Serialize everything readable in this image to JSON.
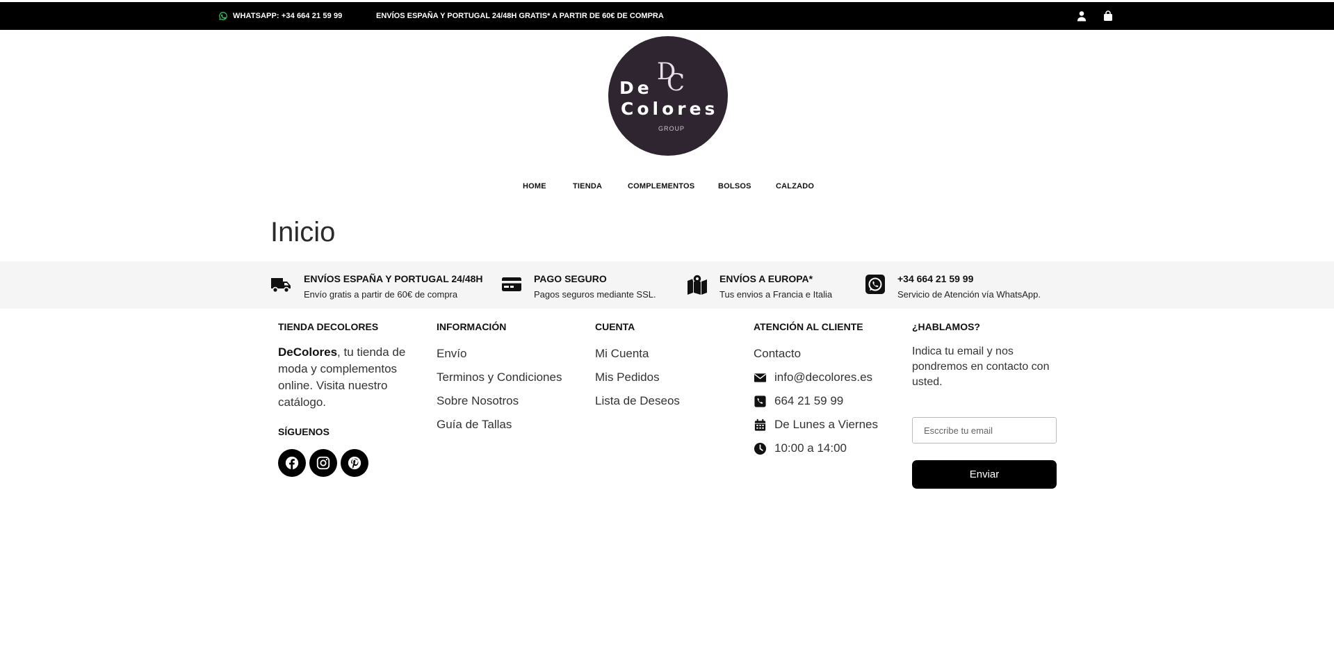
{
  "topbar": {
    "whatsapp": "WHATSAPP: +34 664 21 59 99",
    "shipping": "ENVÍOS ESPAÑA Y PORTUGAL 24/48H GRATIS* A PARTIR DE 60€ DE COMPRA",
    "whatsapp_icon_color": "#25d366"
  },
  "logo": {
    "monogram": "DC",
    "line1": "De",
    "line2": "Colores",
    "line3": "GROUP",
    "bg_color": "#2e2530"
  },
  "nav": [
    "HOME",
    "TIENDA",
    "COMPLEMENTOS",
    "BOLSOS",
    "CALZADO"
  ],
  "page_title": "Inicio",
  "features": [
    {
      "icon": "truck-icon",
      "title": "ENVÍOS ESPAÑA Y PORTUGAL 24/48H",
      "subtitle": "Envío gratis a partir de 60€ de compra"
    },
    {
      "icon": "credit-card-icon",
      "title": "PAGO SEGURO",
      "subtitle": "Pagos seguros mediante SSL."
    },
    {
      "icon": "map-icon",
      "title": "ENVÍOS A EUROPA*",
      "subtitle": "Tus envios a Francia e Italia"
    },
    {
      "icon": "whatsapp-icon",
      "title": "+34 664 21 59 99",
      "subtitle": "Servicio de Atención vía WhatsApp."
    }
  ],
  "footer": {
    "store": {
      "heading": "TIENDA DECOLORES",
      "brand": "DeColores",
      "text": ", tu tienda de moda y complementos online. Visita nuestro catálogo.",
      "follow_heading": "SÍGUENOS",
      "socials": [
        "facebook-icon",
        "instagram-icon",
        "pinterest-icon"
      ]
    },
    "info": {
      "heading": "INFORMACIÓN",
      "links": [
        "Envío",
        "Terminos y Condiciones",
        "Sobre Nosotros",
        "Guía de Tallas"
      ]
    },
    "account": {
      "heading": "CUENTA",
      "links": [
        "Mi Cuenta",
        "Mis Pedidos",
        "Lista de Deseos"
      ]
    },
    "support": {
      "heading": "ATENCIÓN AL CLIENTE",
      "contact": "Contacto",
      "email": "info@decolores.es",
      "phone": "664 21 59 99",
      "days": "De Lunes a Viernes",
      "hours": "10:00 a 14:00"
    },
    "newsletter": {
      "heading": "¿HABLAMOS?",
      "text": "Indica tu email y nos pondremos en contacto con usted.",
      "placeholder": "Esccribe tu email",
      "button": "Enviar"
    }
  }
}
